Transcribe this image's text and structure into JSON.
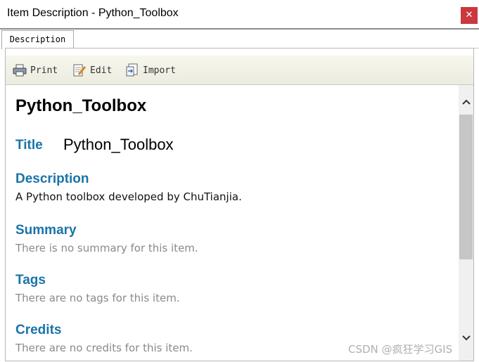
{
  "window": {
    "title": "Item Description - Python_Toolbox",
    "close_label": "✕"
  },
  "tabs": [
    {
      "label": "Description"
    }
  ],
  "toolbar": {
    "print_label": "Print",
    "edit_label": "Edit",
    "import_label": "Import"
  },
  "item": {
    "heading": "Python_Toolbox",
    "title_label": "Title",
    "title_value": "Python_Toolbox",
    "description_label": "Description",
    "description_text": "A Python toolbox developed by ChuTianjia.",
    "summary_label": "Summary",
    "summary_text": "There is no summary for this item.",
    "tags_label": "Tags",
    "tags_text": "There are no tags for this item.",
    "credits_label": "Credits",
    "credits_text": "There are no credits for this item."
  },
  "watermark": "CSDN @疯狂学习GIS",
  "colors": {
    "section_heading": "#1a73a8",
    "close_button": "#c9393d",
    "muted_text": "#8a8a8a"
  }
}
